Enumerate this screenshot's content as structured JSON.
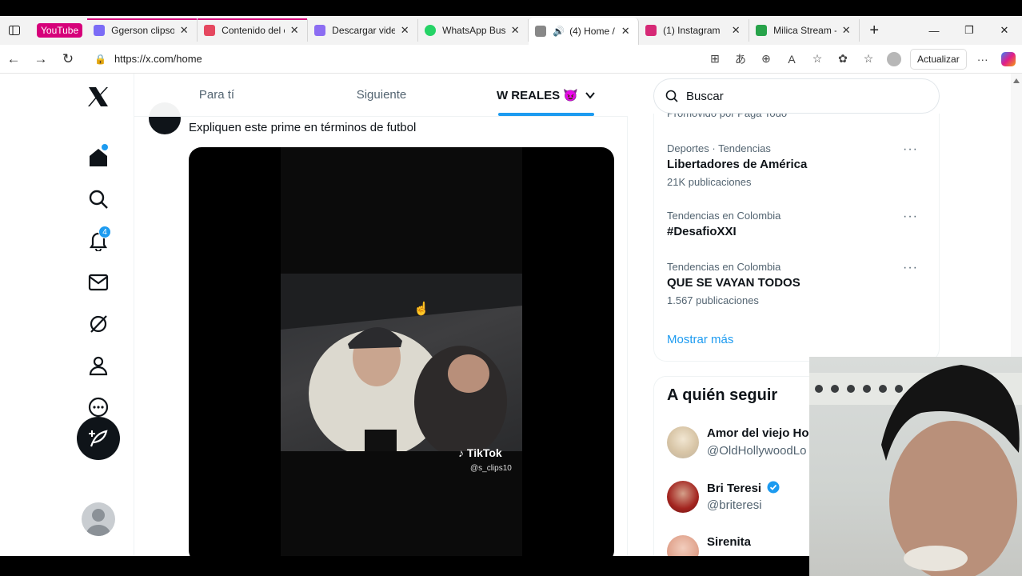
{
  "browser": {
    "tab_group": "YouTube",
    "tabs": [
      {
        "label": "Ggerson clipso -",
        "color": "#7b6cf6"
      },
      {
        "label": "Contenido del c",
        "color": "#e5485f"
      },
      {
        "label": "Descargar video",
        "color": "#8c6df2"
      },
      {
        "label": "WhatsApp Busi",
        "color": "#25d366"
      },
      {
        "label": "(4) Home /",
        "color": "#888888"
      },
      {
        "label": "(1) Instagram",
        "color": "#d62976"
      },
      {
        "label": "Milica Stream -",
        "color": "#27a34a"
      }
    ],
    "url": "https://x.com/home",
    "update_label": "Actualizar"
  },
  "leftnav": {
    "notification_count": "4"
  },
  "feed": {
    "tabs": [
      "Para tí",
      "Siguiente",
      "W REALES 😈"
    ],
    "active_tab": 2,
    "post_text": "Expliquen este prime en términos de futbol",
    "video": {
      "watermark": "TikTok",
      "handle": "@s_clips10"
    }
  },
  "sidebar": {
    "search_placeholder": "Buscar",
    "promoted_text": "Promovido por Paga Todo",
    "trends": [
      {
        "meta": "Deportes · Tendencias",
        "title": "Libertadores de América",
        "count": "21K publicaciones"
      },
      {
        "meta": "Tendencias en Colombia",
        "title": "#DesafioXXI",
        "count": ""
      },
      {
        "meta": "Tendencias en Colombia",
        "title": "QUE SE VAYAN TODOS",
        "count": "1.567 publicaciones"
      }
    ],
    "show_more": "Mostrar más",
    "follow_title": "A quién seguir",
    "follow": [
      {
        "name": "Amor del viejo Ho",
        "handle": "@OldHollywoodLo"
      },
      {
        "name": "Bri Teresi",
        "handle": "@briteresi",
        "verified": true
      },
      {
        "name": "Sirenita",
        "handle": ""
      }
    ]
  },
  "colors": {
    "accent": "#1d9bf0",
    "text": "#0f1419",
    "muted": "#536471",
    "tab_group": "#d6007a"
  }
}
